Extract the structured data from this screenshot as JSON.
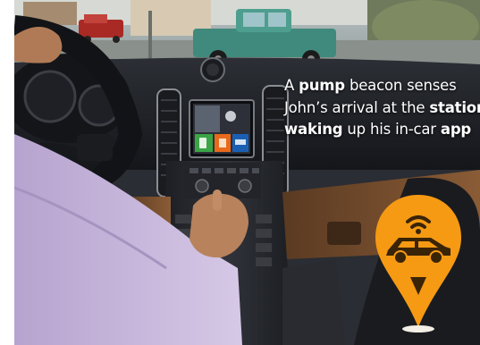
{
  "caption": {
    "line1": {
      "t1": "A ",
      "b1": "pump",
      "t2": " beacon senses"
    },
    "line2": {
      "t1": "John’s arrival at the ",
      "b1": "station",
      "t2": ","
    },
    "line3": {
      "b1": "waking",
      "t1": " up his in-car ",
      "b2": "app"
    }
  },
  "icons": {
    "pin": "location-pin-icon",
    "car": "car-icon",
    "signal": "wifi-signal-icon"
  },
  "colors": {
    "pin_orange": "#f59a12",
    "car_dark": "#3a2408",
    "tile_green": "#3aa446",
    "tile_orange": "#e96a1c",
    "tile_blue": "#1b5fb3"
  }
}
